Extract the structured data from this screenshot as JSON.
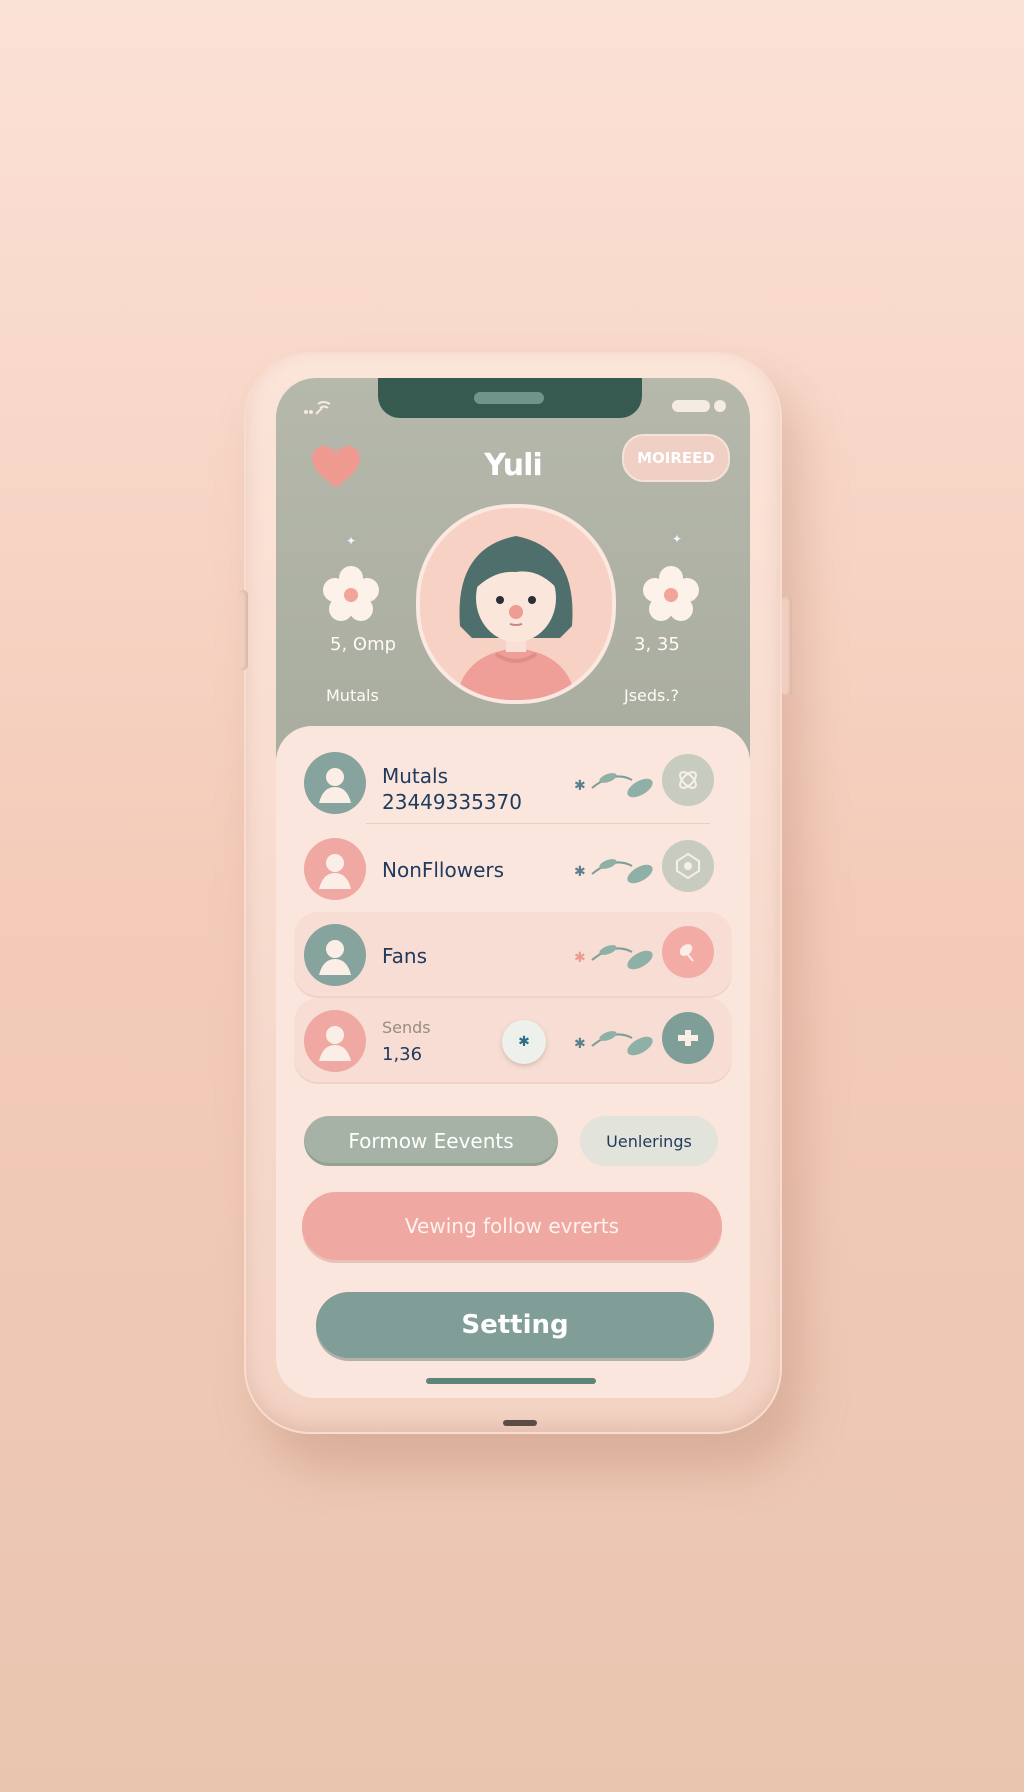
{
  "status_bar": {
    "wifi_icon": "wifi-icon"
  },
  "header": {
    "title": "Yuli",
    "badge": "MOIREED",
    "left_stat": {
      "value": "5, Ꙩmp",
      "label": "Mutals"
    },
    "right_stat": {
      "value": "3, 35",
      "label": "Jseds.?"
    }
  },
  "list": {
    "items": [
      {
        "title": "Mutals",
        "subtitle": "23449335370",
        "avatar_color": "#86a39d",
        "action_color": "#c7cbc0",
        "action_icon": "knot-icon"
      },
      {
        "title": "NonFllowers",
        "subtitle": "",
        "avatar_color": "#f0a8a3",
        "action_color": "#c7cbc0",
        "action_icon": "pattern-icon"
      },
      {
        "title": "Fans",
        "subtitle": "",
        "avatar_color": "#86a39d",
        "action_color": "#f2aca5",
        "action_icon": "leaf-icon"
      },
      {
        "title": "Sends",
        "subtitle": "1,36",
        "avatar_color": "#f0a8a3",
        "action_color": "#7f9e98",
        "action_icon": "plus-icon"
      }
    ]
  },
  "buttons": {
    "follow_events": "Formow Eevents",
    "underings": "Uenlerings",
    "viewing_events": "Vewing follow evrerts",
    "setting": "Setting"
  },
  "colors": {
    "header_bg": "#aeb1a4",
    "pink": "#f0a9a2",
    "green": "#809d97",
    "text_dark": "#213b5e"
  }
}
